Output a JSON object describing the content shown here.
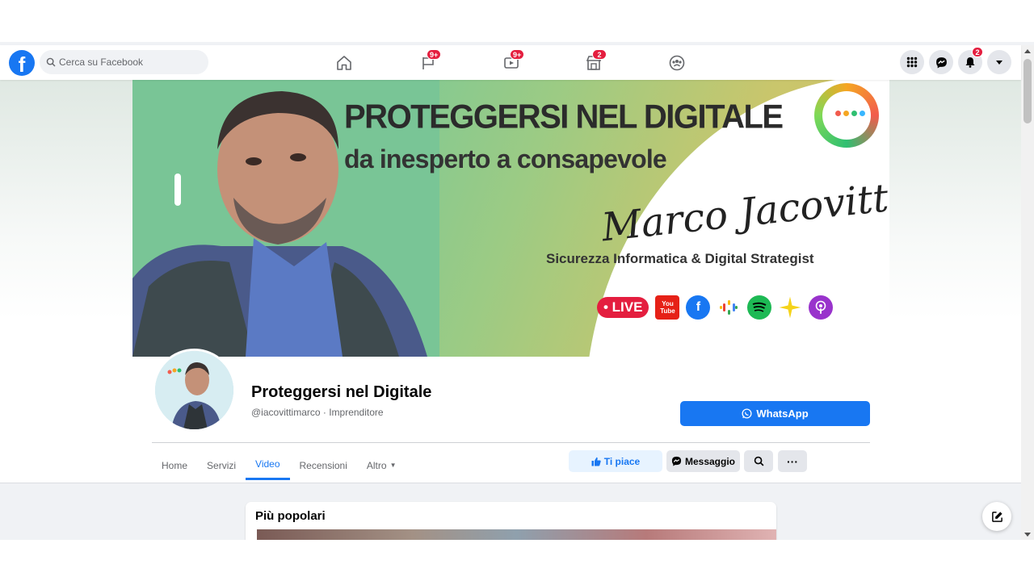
{
  "app": {
    "name": "Facebook",
    "brand_color": "#1877f2"
  },
  "search": {
    "placeholder": "Cerca su Facebook"
  },
  "nav": {
    "items": [
      {
        "name": "home",
        "badge": ""
      },
      {
        "name": "pages",
        "badge": "9+"
      },
      {
        "name": "watch",
        "badge": "9+"
      },
      {
        "name": "marketplace",
        "badge": "2"
      },
      {
        "name": "groups",
        "badge": ""
      }
    ],
    "notifications_badge": "2"
  },
  "cover": {
    "title": "PROTEGGERSI NEL DIGITALE",
    "subtitle": "da inesperto a consapevole",
    "signature": "Marco Jacovitti",
    "tagline": "Sicurezza Informatica & Digital Strategist",
    "live_label": "• LIVE",
    "youtube_label": "You Tube"
  },
  "profile": {
    "name": "Proteggersi nel Digitale",
    "subtitle": "@iacovittimarco · Imprenditore",
    "whatsapp_label": "WhatsApp"
  },
  "tabs": [
    {
      "label": "Home",
      "active": false
    },
    {
      "label": "Servizi",
      "active": false
    },
    {
      "label": "Video",
      "active": true
    },
    {
      "label": "Recensioni",
      "active": false
    },
    {
      "label": "Altro",
      "active": false
    }
  ],
  "actions": {
    "like_label": "Ti piace",
    "message_label": "Messaggio"
  },
  "section": {
    "title": "Più popolari"
  }
}
